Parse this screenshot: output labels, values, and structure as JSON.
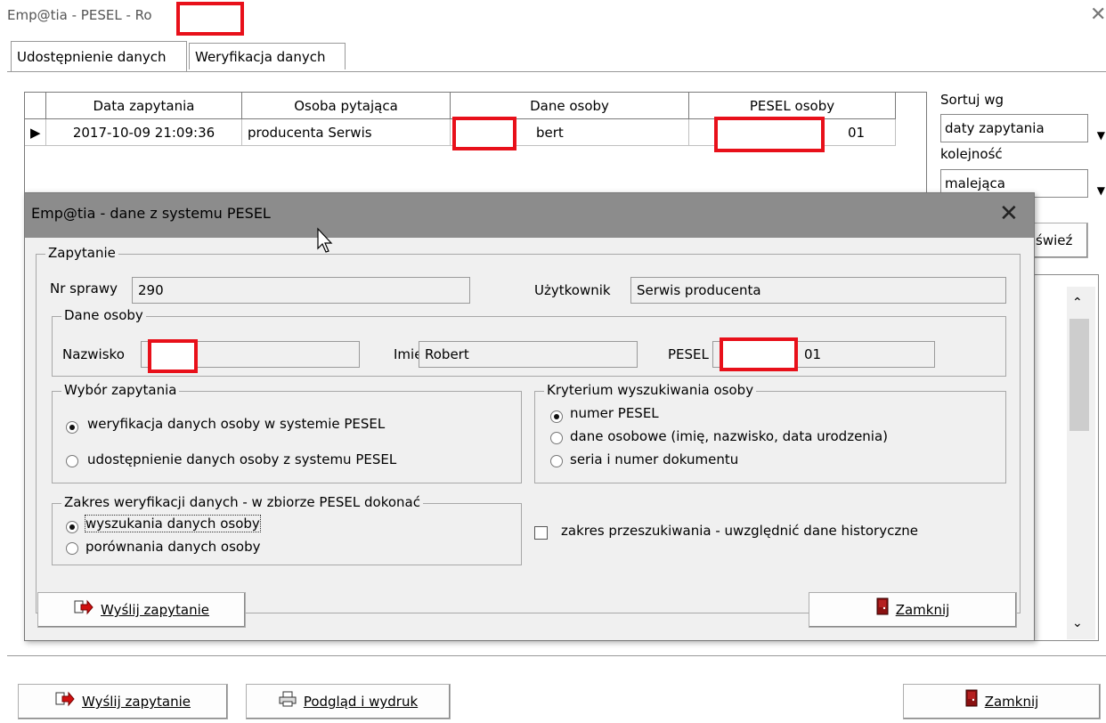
{
  "window": {
    "title": "Emp@tia - PESEL - Ro"
  },
  "tabs": [
    "Udostępnienie danych",
    "Weryfikacja danych"
  ],
  "grid": {
    "columns": [
      "Data zapytania",
      "Osoba pytająca",
      "Dane osoby",
      "PESEL osoby"
    ],
    "rows": [
      {
        "date": "2017-10-09 21:09:36",
        "requester": "producenta Serwis",
        "person": "bert",
        "pesel": "01"
      }
    ]
  },
  "side": {
    "sort_label": "Sortuj wg",
    "sort_value": "daty zapytania",
    "order_label": "kolejność",
    "order_value": "malejąca",
    "refresh_label": "świeź"
  },
  "dialog": {
    "title": "Emp@tia - dane z systemu PESEL",
    "query_group": "Zapytanie",
    "case_label": "Nr sprawy",
    "case_value": "290",
    "user_label": "Użytkownik",
    "user_value": "Serwis producenta",
    "person_group": "Dane osoby",
    "surname_label": "Nazwisko",
    "surname_value": "",
    "name_label": "Imię",
    "name_value": "Robert",
    "pesel_label": "PESEL",
    "pesel_value": "01",
    "choice_group": "Wybór zapytania",
    "choice_options": [
      "weryfikacja danych osoby w systemie PESEL",
      "udostępnienie danych osoby z systemu PESEL"
    ],
    "criteria_group": "Kryterium wyszukiwania osoby",
    "criteria_options": [
      "numer PESEL",
      "dane osobowe (imię, nazwisko, data urodzenia)",
      "seria i numer dokumentu"
    ],
    "scope_group": "Zakres weryfikacji danych - w zbiorze PESEL dokonać",
    "scope_options": [
      "wyszukania danych osoby",
      "porównania danych osoby"
    ],
    "history_label": "zakres przeszukiwania - uwzględnić dane historyczne",
    "send_button": "Wyślij zapytanie",
    "close_button": "Zamknij"
  },
  "footer": {
    "send_button": "Wyślij zapytanie",
    "preview_button": "Podgląd i wydruk",
    "close_button": "Zamknij"
  },
  "colors": {
    "redaction": "#e8101a",
    "dialog_titlebar": "#8c8c8c"
  }
}
